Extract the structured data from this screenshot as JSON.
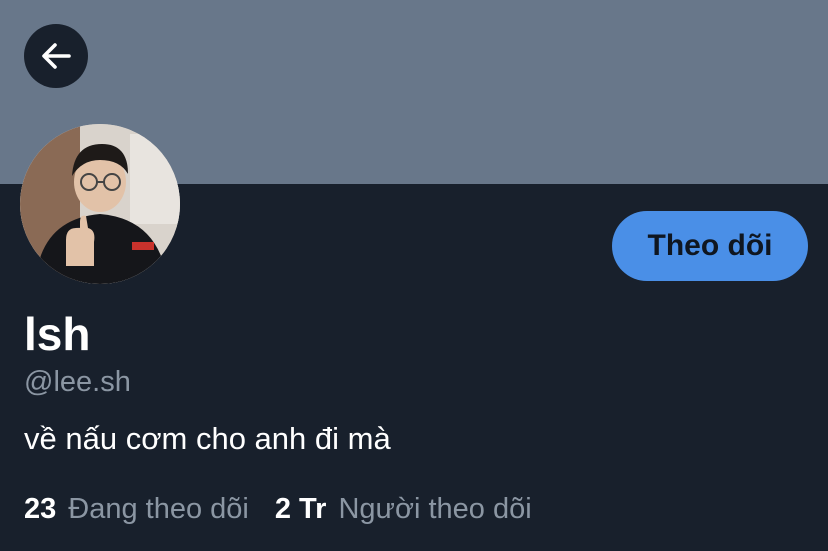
{
  "profile": {
    "display_name": "lsh",
    "handle": "@lee.sh",
    "bio": "về nấu cơm cho anh đi mà"
  },
  "actions": {
    "follow_label": "Theo dõi"
  },
  "stats": {
    "following_count": "23",
    "following_label": "Đang theo dõi",
    "followers_count": "2 Tr",
    "followers_label": "Người theo dõi"
  },
  "icons": {
    "back": "arrow-left-icon"
  },
  "colors": {
    "banner": "#68778a",
    "background": "#18202c",
    "accent": "#4a8fe7",
    "secondary_text": "#8b96a3"
  }
}
